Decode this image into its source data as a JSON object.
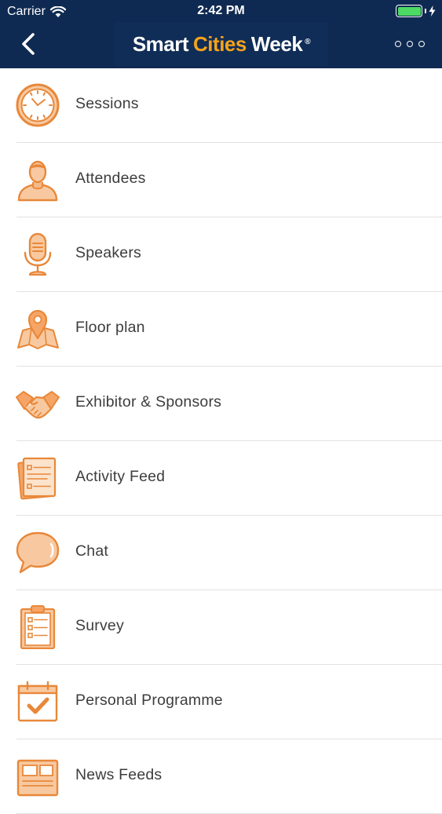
{
  "status_bar": {
    "carrier": "Carrier",
    "time": "2:42 PM"
  },
  "header": {
    "logo_word_1": "Smart",
    "logo_word_2": "Cities",
    "logo_word_3": "Week",
    "logo_mark": "®",
    "back_icon": "chevron-left-icon",
    "more_icon": "more-dots-icon"
  },
  "colors": {
    "header_bg": "#0f2a52",
    "accent": "#f6a21a",
    "icon_orange": "#e8883a",
    "icon_fill": "#f8c9a0",
    "text": "#3d3d3d",
    "separator": "#e2e2e2"
  },
  "menu": {
    "items": [
      {
        "label": "Sessions",
        "icon": "clock-icon"
      },
      {
        "label": "Attendees",
        "icon": "person-icon"
      },
      {
        "label": "Speakers",
        "icon": "microphone-icon"
      },
      {
        "label": "Floor plan",
        "icon": "map-pin-icon"
      },
      {
        "label": "Exhibitor & Sponsors",
        "icon": "handshake-icon"
      },
      {
        "label": "Activity Feed",
        "icon": "document-stack-icon"
      },
      {
        "label": "Chat",
        "icon": "chat-bubble-icon"
      },
      {
        "label": "Survey",
        "icon": "clipboard-icon"
      },
      {
        "label": "Personal Programme",
        "icon": "calendar-check-icon"
      },
      {
        "label": "News Feeds",
        "icon": "newspaper-icon"
      }
    ]
  }
}
